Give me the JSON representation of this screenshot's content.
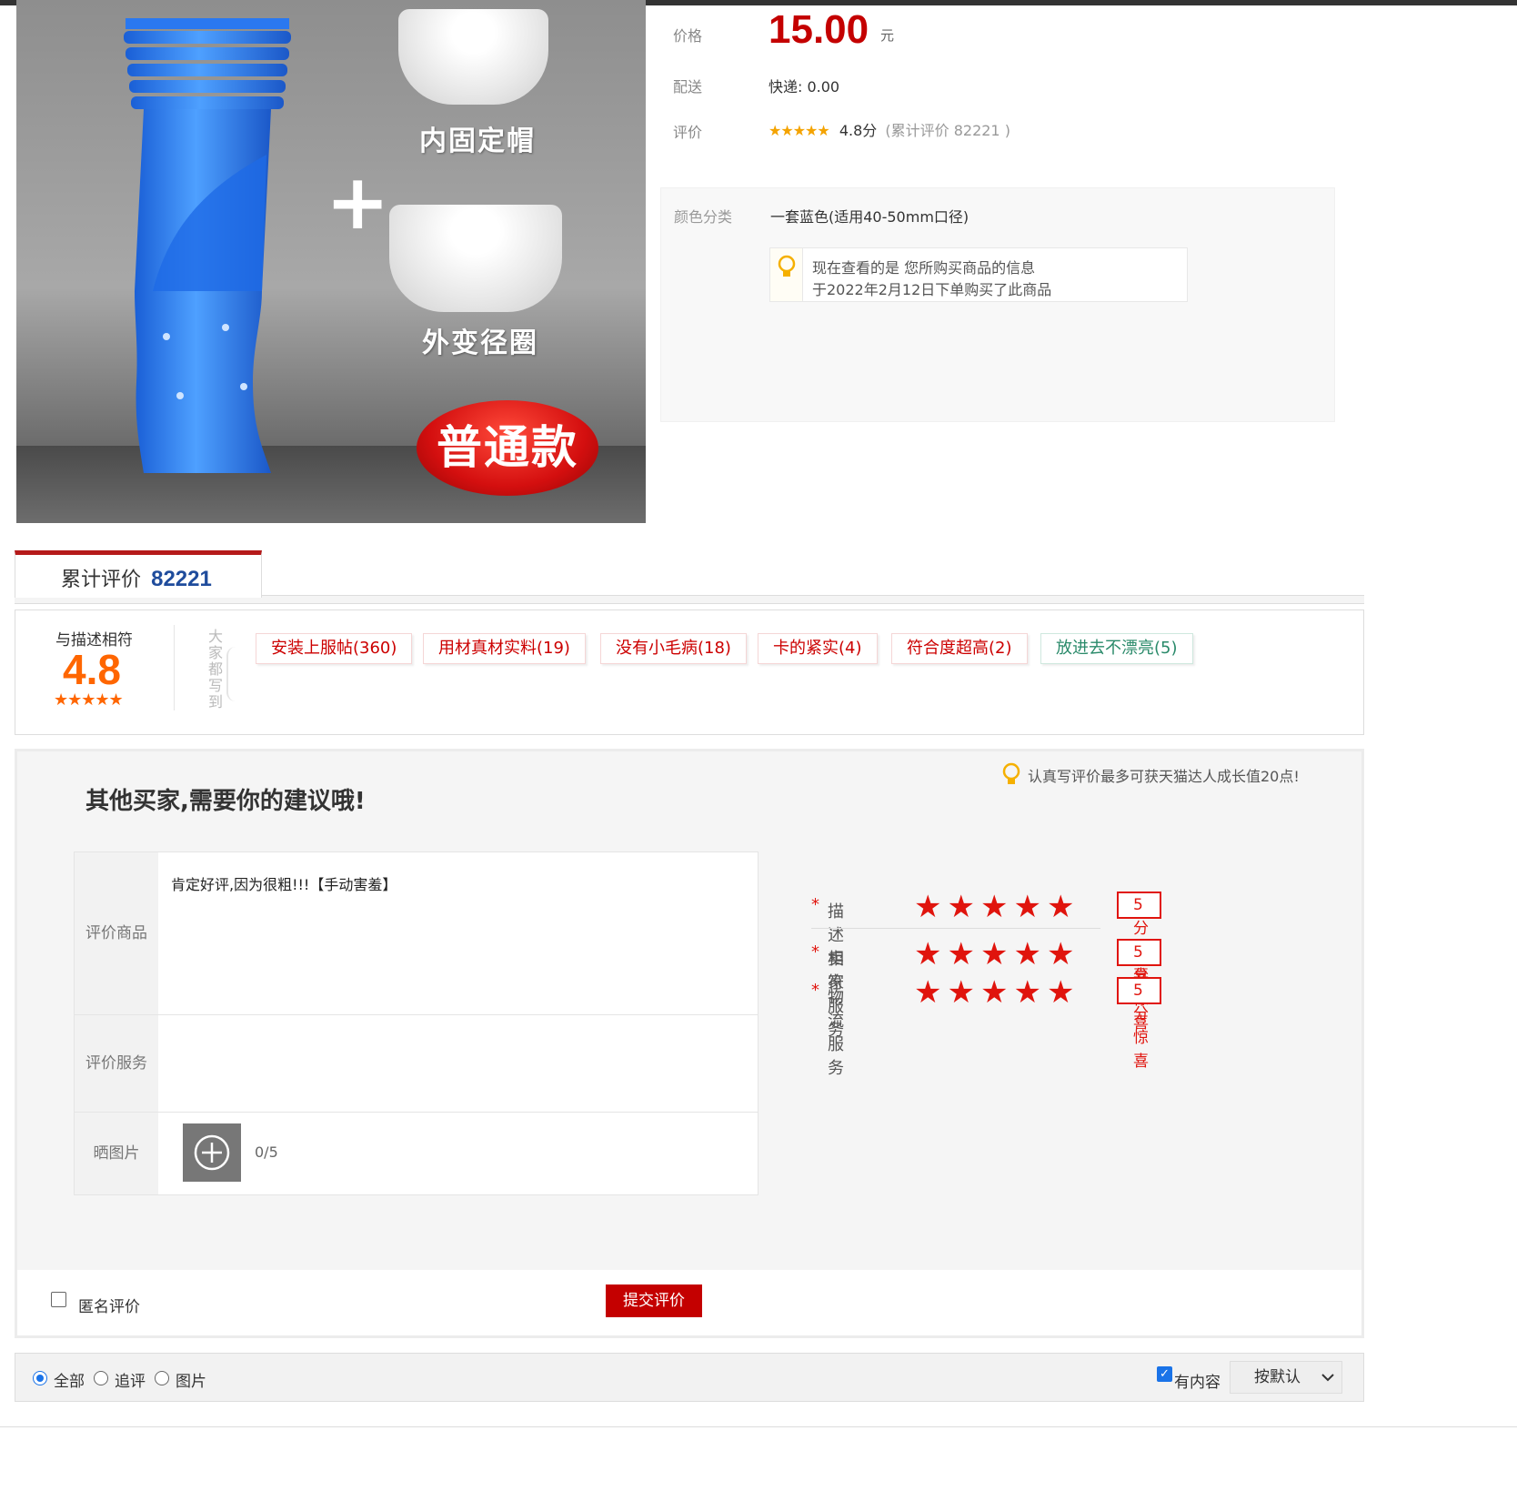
{
  "product": {
    "image_labels": {
      "inner_cap": "内固定帽",
      "outer_ring": "外变径圈",
      "plus": "+",
      "badge": "普通款"
    },
    "price_label": "价格",
    "price": "15.00",
    "currency": "元",
    "delivery_label": "配送",
    "delivery_value": "快递: 0.00",
    "rating_label": "评价",
    "rating_stars": "★★★★★",
    "rating_score": "4.8分",
    "rating_count_prefix": "(累计评价",
    "rating_count": "82221",
    "rating_count_suffix": ")",
    "color_label": "颜色分类",
    "color_value": "一套蓝色(适用40-50mm口径)",
    "notice_line1": "现在查看的是 您所购买商品的信息",
    "notice_line2": "于2022年2月12日下单购买了此商品"
  },
  "reviews_tab": {
    "label": "累计评价",
    "count": "82221"
  },
  "summary": {
    "label": "与描述相符",
    "score": "4.8",
    "stars": "★★★★★",
    "vertical_label": "大家都写到",
    "tags": [
      {
        "text": "安装上服帖(360)",
        "tone": "neg"
      },
      {
        "text": "用材真材实料(19)",
        "tone": "neg"
      },
      {
        "text": "没有小毛病(18)",
        "tone": "neg"
      },
      {
        "text": "卡的紧实(4)",
        "tone": "neg"
      },
      {
        "text": "符合度超高(2)",
        "tone": "neg"
      },
      {
        "text": "放进去不漂亮(5)",
        "tone": "pos"
      }
    ]
  },
  "review_form": {
    "title": "其他买家,需要你的建议哦!",
    "tip": "认真写评价最多可获天猫达人成长值20点!",
    "product_label": "评价商品",
    "product_text": "肯定好评,因为很粗!!!【手动害羞】",
    "service_label": "评价服务",
    "photo_label": "晒图片",
    "photo_count": "0/5",
    "ratings": [
      {
        "label": "描述相符",
        "score": "5分",
        "word": "惊喜",
        "stars": 5
      },
      {
        "label": "卖家服务",
        "score": "5分",
        "word": "惊喜",
        "stars": 5
      },
      {
        "label": "物流服务",
        "score": "5分",
        "word": "惊喜",
        "stars": 5
      }
    ],
    "required_mark": "*",
    "anonymous_label": "匿名评价",
    "anonymous_checked": false,
    "submit_label": "提交评价"
  },
  "filter": {
    "options": [
      {
        "label": "全部",
        "selected": true
      },
      {
        "label": "追评",
        "selected": false
      },
      {
        "label": "图片",
        "selected": false
      }
    ],
    "has_content_label": "有内容",
    "has_content_checked": true,
    "sort_label": "按默认"
  },
  "colors": {
    "price_red": "#c40000",
    "score_orange": "#ff6600",
    "star_red": "#e0140d",
    "tab_accent": "#b51a1a",
    "count_blue": "#1f4c9c"
  }
}
